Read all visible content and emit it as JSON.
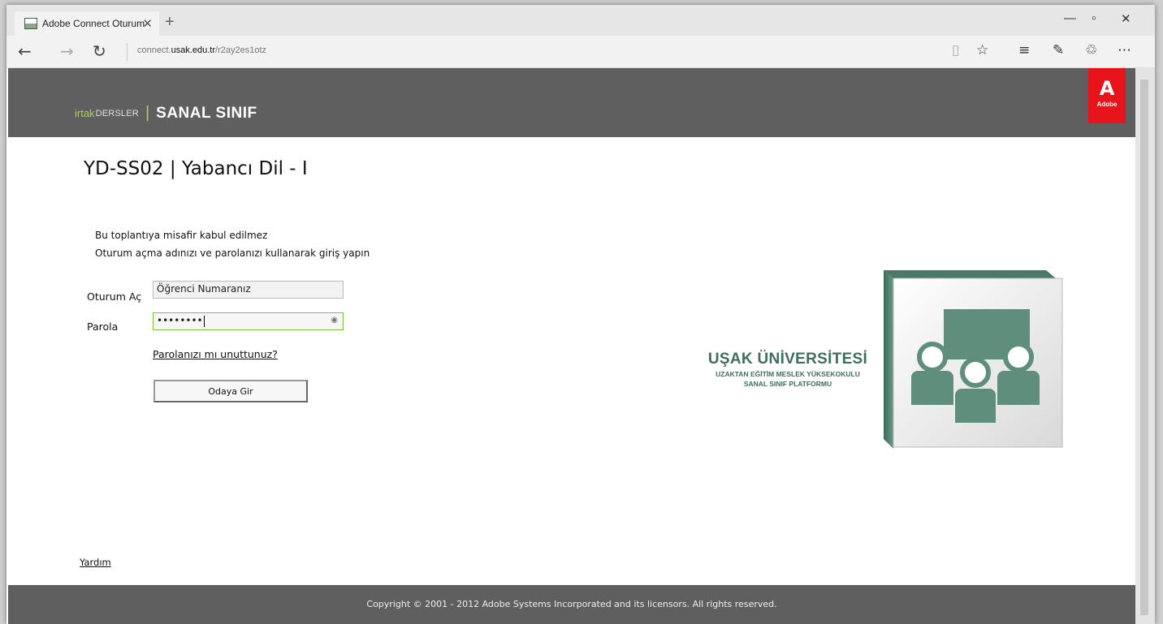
{
  "browser": {
    "tab_title": "Adobe Connect Oturum",
    "new_tab": "+",
    "url_prefix": "connect.",
    "url_domain": "usak.edu.tr",
    "url_path": "/r2ay2es1otz",
    "accent_color": "#a8d35c"
  },
  "header": {
    "brand_irtak": "irtak",
    "brand_dersler": "DERSLER",
    "brand_divider": "|",
    "brand_name": "SANAL SINIF",
    "adobe_mark": "A",
    "adobe_text": "Adobe",
    "adobe_color": "#e8141c"
  },
  "main": {
    "title": "YD-SS02 | Yabancı Dil - I",
    "notice_guest": "Bu toplantıya misafir kabul edilmez",
    "notice_login": "Oturum açma adınızı ve parolanızı kullanarak giriş yapın",
    "login_label": "Oturum Aç",
    "login_value": "Öğrenci Numaranız",
    "password_label": "Parola",
    "password_value": "••••••••",
    "forgot_link": "Parolanızı mı unuttunuz?",
    "enter_button": "Odaya Gir",
    "help_link": "Yardım"
  },
  "university": {
    "name": "UŞAK ÜNİVERSİTESİ",
    "line1": "UZAKTAN EĞİTİM MESLEK YÜKSEKOKULU",
    "line2": "SANAL SINIF PLATFORMU",
    "color": "#3f6e5c"
  },
  "footer": {
    "copyright": "Copyright © 2001 - 2012 Adobe Systems Incorporated and its licensors. All rights reserved."
  }
}
